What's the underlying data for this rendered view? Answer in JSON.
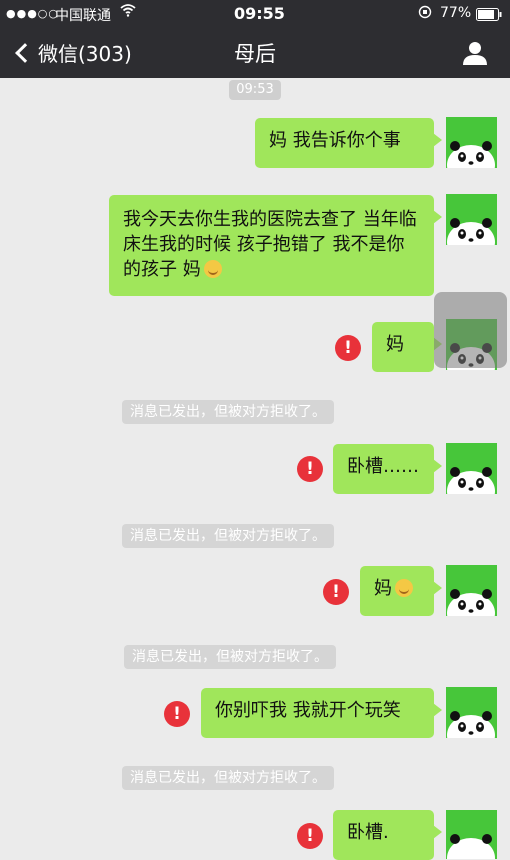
{
  "status_bar": {
    "signal": "●●●○○",
    "carrier": "中国联通",
    "wifi_icon": "wifi-icon",
    "time": "09:55",
    "battery": "77%"
  },
  "nav": {
    "back_label": "微信(303)",
    "title": "母后",
    "profile_icon": "person-icon"
  },
  "chat": {
    "time_badge": "09:53",
    "messages": [
      {
        "text": "妈 我告诉你个事",
        "failed": false
      },
      {
        "text": "我今天去你生我的医院去查了 当年临床生我的时候 孩子抱错了 我不是你的孩子 妈",
        "emoji": "smile-emoji",
        "failed": false
      },
      {
        "text": "妈",
        "failed": true
      },
      {
        "system": "消息已发出，但被对方拒收了。"
      },
      {
        "text": "卧槽……",
        "failed": true
      },
      {
        "system": "消息已发出，但被对方拒收了。"
      },
      {
        "text": "妈",
        "emoji": "smile-emoji",
        "failed": true
      },
      {
        "system": "消息已发出，但被对方拒收了。"
      },
      {
        "text": "你别吓我 我就开个玩笑",
        "failed": true
      },
      {
        "system": "消息已发出，但被对方拒收了。"
      },
      {
        "text": "卧槽.",
        "failed": true
      }
    ],
    "error_mark": "!"
  }
}
